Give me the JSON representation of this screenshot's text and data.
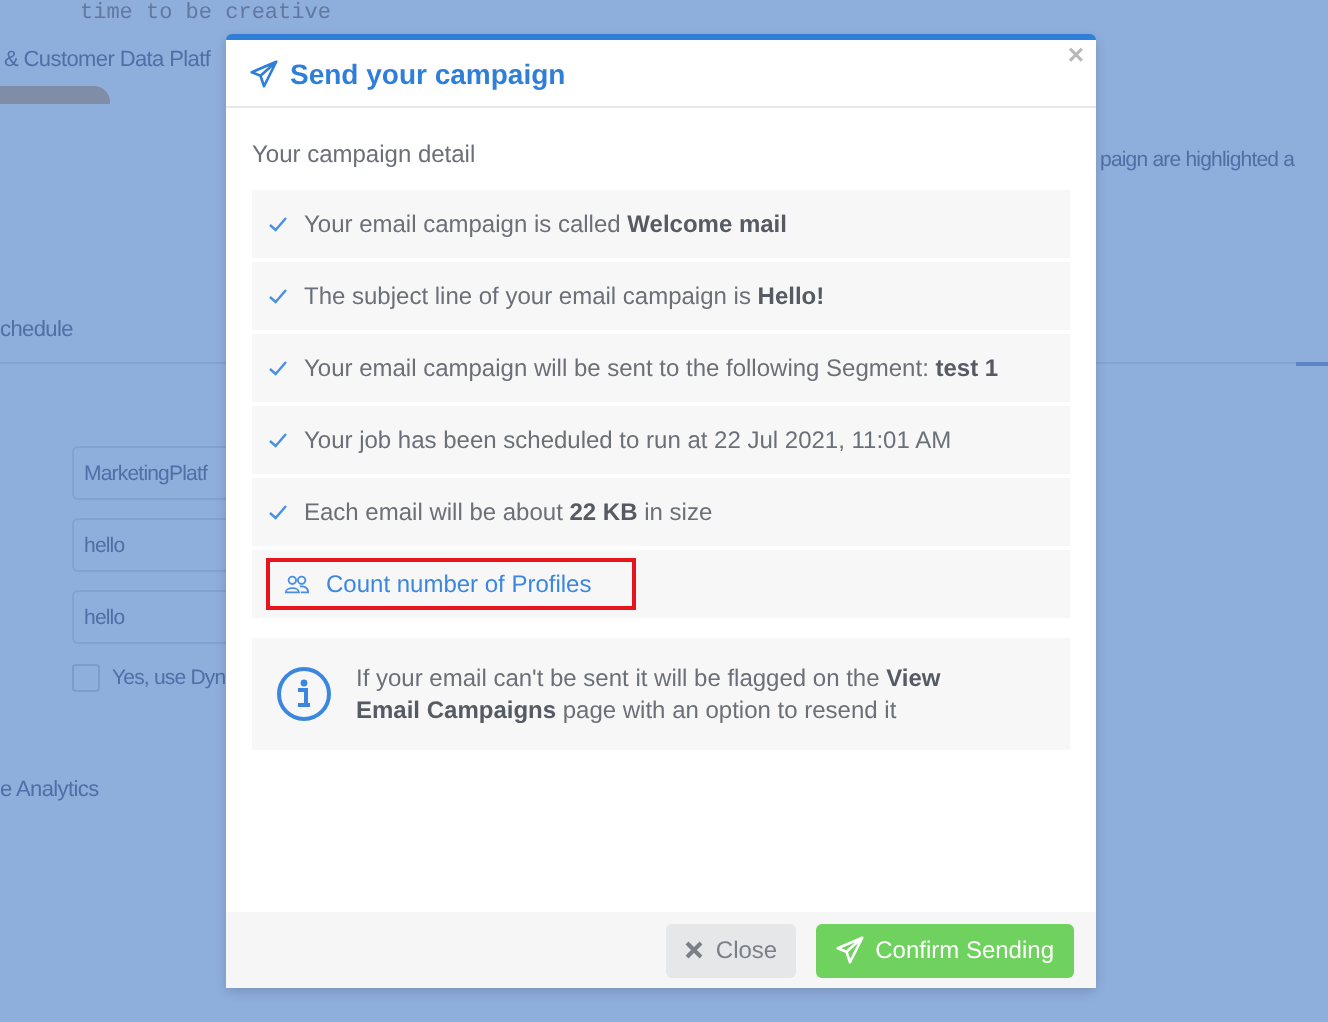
{
  "background": {
    "tagline": "time to be creative",
    "breadcrumb": "& Customer Data Platf",
    "notice": "paign are highlighted a",
    "tab": "chedule",
    "fields": [
      {
        "value": "MarketingPlatf"
      },
      {
        "value": "hello"
      },
      {
        "value": "hello"
      }
    ],
    "checkbox": {
      "label": "Yes, use Dyn",
      "checked": false
    },
    "section": "e Analytics"
  },
  "modal": {
    "title": "Send your campaign",
    "close": "×",
    "subtitle": "Your campaign detail",
    "details": [
      {
        "text": "Your email campaign is called **Welcome mail**"
      },
      {
        "text": "The subject line of your email campaign is **Hello!**"
      },
      {
        "text": "Your email campaign will be sent to the following Segment: **test 1**"
      },
      {
        "text": "Your job has been scheduled to run at 22 Jul 2021, 11:01 AM"
      },
      {
        "text": "Each email will be about **22 KB** in size"
      }
    ],
    "count_link": {
      "label": "Count number of Profiles",
      "highlighted": true
    },
    "info": "If your email can't be sent it will be flagged on the **View Email Campaigns** page with an option to resend it",
    "buttons": [
      {
        "label": "Close",
        "kind": "close"
      },
      {
        "label": "Confirm Sending",
        "kind": "confirm"
      }
    ]
  }
}
